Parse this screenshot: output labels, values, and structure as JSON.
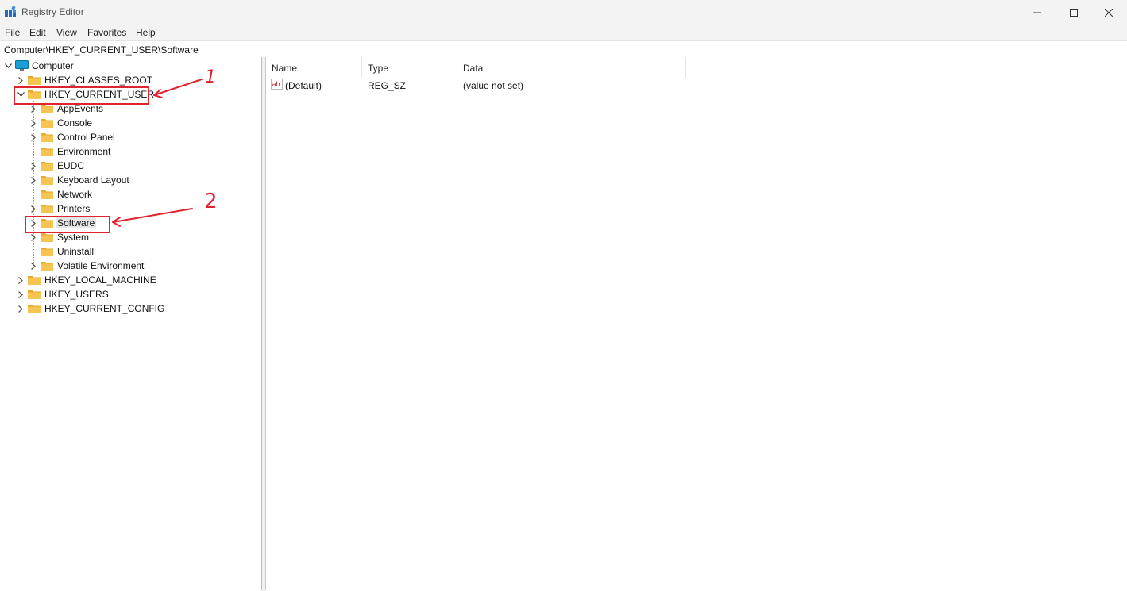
{
  "window": {
    "title": "Registry Editor"
  },
  "menu": [
    "File",
    "Edit",
    "View",
    "Favorites",
    "Help"
  ],
  "address": "Computer\\HKEY_CURRENT_USER\\Software",
  "tree": {
    "root": "Computer",
    "hives": [
      "HKEY_CLASSES_ROOT",
      "HKEY_CURRENT_USER",
      "HKEY_LOCAL_MACHINE",
      "HKEY_USERS",
      "HKEY_CURRENT_CONFIG"
    ],
    "current_user_children": [
      "AppEvents",
      "Console",
      "Control Panel",
      "Environment",
      "EUDC",
      "Keyboard Layout",
      "Network",
      "Printers",
      "Software",
      "System",
      "Uninstall",
      "Volatile Environment"
    ],
    "selected": "Software"
  },
  "values": {
    "columns": [
      "Name",
      "Type",
      "Data"
    ],
    "rows": [
      {
        "name": "(Default)",
        "type": "REG_SZ",
        "data": "(value not set)"
      }
    ]
  },
  "annotations": {
    "label_1": "1",
    "label_2": "2",
    "color": "#e0242f"
  },
  "colors": {
    "folder": "#f5c451",
    "folder_dark": "#e5a92c",
    "selection": "#e5e5e5",
    "app_icon": "#1f6fbf"
  }
}
